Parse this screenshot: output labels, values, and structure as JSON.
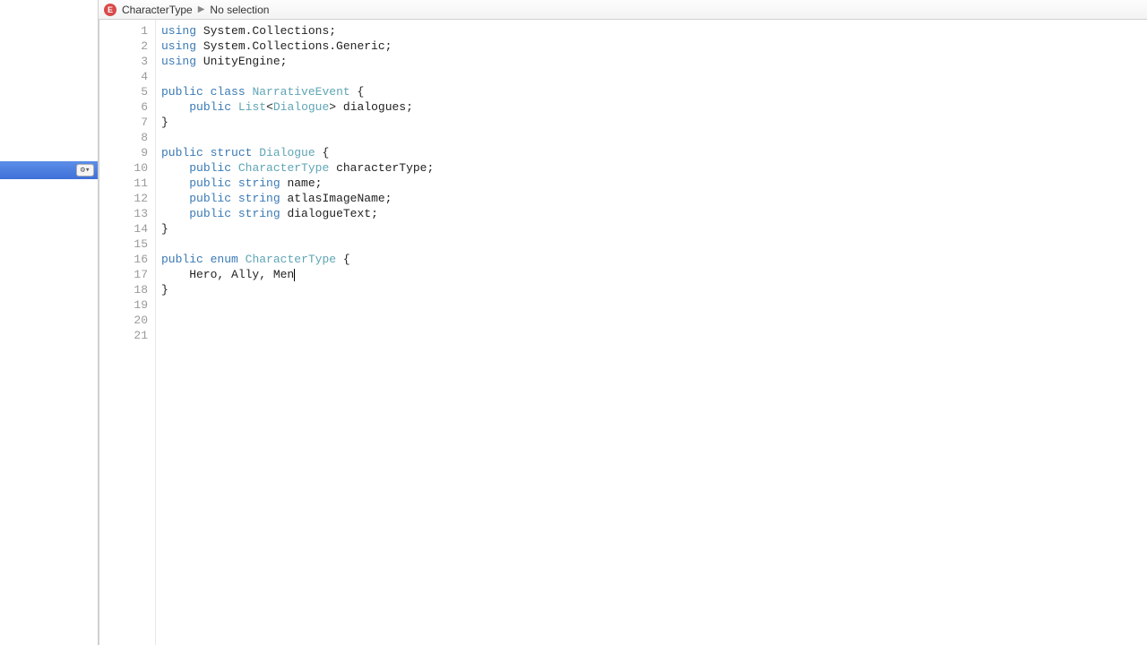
{
  "breadcrumb": {
    "icon_letter": "E",
    "symbol": "CharacterType",
    "selection": "No selection"
  },
  "sidebar": {
    "gear_label": "⚙▾"
  },
  "code": {
    "lines": [
      {
        "n": 1,
        "tokens": [
          {
            "t": "using",
            "c": "kw"
          },
          {
            "t": " System.Collections;",
            "c": ""
          }
        ]
      },
      {
        "n": 2,
        "tokens": [
          {
            "t": "using",
            "c": "kw"
          },
          {
            "t": " System.Collections.Generic;",
            "c": ""
          }
        ]
      },
      {
        "n": 3,
        "tokens": [
          {
            "t": "using",
            "c": "kw"
          },
          {
            "t": " UnityEngine;",
            "c": ""
          }
        ]
      },
      {
        "n": 4,
        "tokens": []
      },
      {
        "n": 5,
        "tokens": [
          {
            "t": "public",
            "c": "kw"
          },
          {
            "t": " ",
            "c": ""
          },
          {
            "t": "class",
            "c": "kw"
          },
          {
            "t": " ",
            "c": ""
          },
          {
            "t": "NarrativeEvent",
            "c": "type"
          },
          {
            "t": " {",
            "c": ""
          }
        ]
      },
      {
        "n": 6,
        "tokens": [
          {
            "t": "    ",
            "c": ""
          },
          {
            "t": "public",
            "c": "kw"
          },
          {
            "t": " ",
            "c": ""
          },
          {
            "t": "List",
            "c": "type"
          },
          {
            "t": "<",
            "c": ""
          },
          {
            "t": "Dialogue",
            "c": "type"
          },
          {
            "t": "> dialogues;",
            "c": ""
          }
        ]
      },
      {
        "n": 7,
        "tokens": [
          {
            "t": "}",
            "c": ""
          }
        ]
      },
      {
        "n": 8,
        "tokens": []
      },
      {
        "n": 9,
        "tokens": [
          {
            "t": "public",
            "c": "kw"
          },
          {
            "t": " ",
            "c": ""
          },
          {
            "t": "struct",
            "c": "kw"
          },
          {
            "t": " ",
            "c": ""
          },
          {
            "t": "Dialogue",
            "c": "type"
          },
          {
            "t": " {",
            "c": ""
          }
        ]
      },
      {
        "n": 10,
        "tokens": [
          {
            "t": "    ",
            "c": ""
          },
          {
            "t": "public",
            "c": "kw"
          },
          {
            "t": " ",
            "c": ""
          },
          {
            "t": "CharacterType",
            "c": "type"
          },
          {
            "t": " characterType;",
            "c": ""
          }
        ]
      },
      {
        "n": 11,
        "tokens": [
          {
            "t": "    ",
            "c": ""
          },
          {
            "t": "public",
            "c": "kw"
          },
          {
            "t": " ",
            "c": ""
          },
          {
            "t": "string",
            "c": "kw"
          },
          {
            "t": " name;",
            "c": ""
          }
        ]
      },
      {
        "n": 12,
        "tokens": [
          {
            "t": "    ",
            "c": ""
          },
          {
            "t": "public",
            "c": "kw"
          },
          {
            "t": " ",
            "c": ""
          },
          {
            "t": "string",
            "c": "kw"
          },
          {
            "t": " atlasImageName;",
            "c": ""
          }
        ]
      },
      {
        "n": 13,
        "tokens": [
          {
            "t": "    ",
            "c": ""
          },
          {
            "t": "public",
            "c": "kw"
          },
          {
            "t": " ",
            "c": ""
          },
          {
            "t": "string",
            "c": "kw"
          },
          {
            "t": " dialogueText;",
            "c": ""
          }
        ]
      },
      {
        "n": 14,
        "tokens": [
          {
            "t": "}",
            "c": ""
          }
        ]
      },
      {
        "n": 15,
        "tokens": []
      },
      {
        "n": 16,
        "tokens": [
          {
            "t": "public",
            "c": "kw"
          },
          {
            "t": " ",
            "c": ""
          },
          {
            "t": "enum",
            "c": "kw"
          },
          {
            "t": " ",
            "c": ""
          },
          {
            "t": "CharacterType",
            "c": "type"
          },
          {
            "t": " {",
            "c": ""
          }
        ]
      },
      {
        "n": 17,
        "tokens": [
          {
            "t": "    Hero, Ally, Men",
            "c": ""
          }
        ],
        "caret": true
      },
      {
        "n": 18,
        "tokens": [
          {
            "t": "}",
            "c": ""
          }
        ]
      },
      {
        "n": 19,
        "tokens": []
      },
      {
        "n": 20,
        "tokens": []
      },
      {
        "n": 21,
        "tokens": []
      }
    ]
  }
}
